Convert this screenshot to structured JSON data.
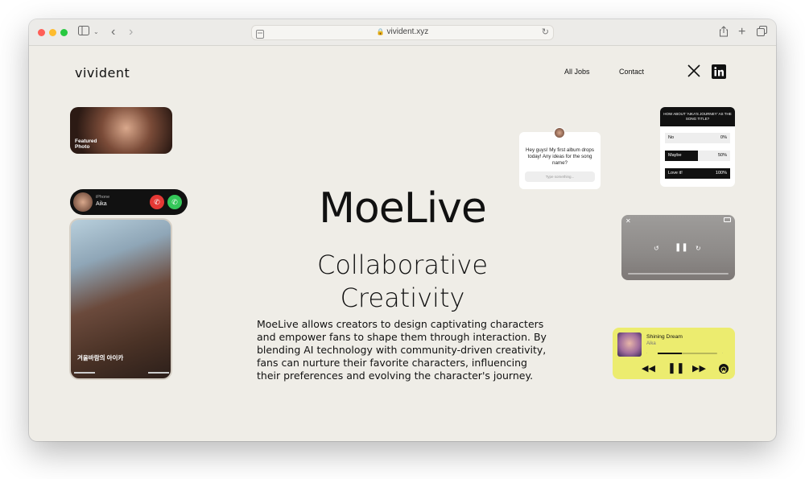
{
  "browser": {
    "url": "vivident.xyz",
    "traffic_light_colors": [
      "#ff5f57",
      "#febc2e",
      "#28c840"
    ]
  },
  "header": {
    "logo": "vivident",
    "nav": [
      {
        "label": "All Jobs"
      },
      {
        "label": "Contact"
      }
    ],
    "social_icons": [
      "x-icon",
      "linkedin-icon"
    ]
  },
  "hero": {
    "title": "MoeLive",
    "subtitle_line1": "Collaborative",
    "subtitle_line2": "Creativity",
    "description": "MoeLive allows creators to design captivating characters and empower fans to shape them through interaction. By blending AI technology with community-driven creativity, fans can nurture their favorite characters, influencing their preferences and evolving the character's journey."
  },
  "featured_photo": {
    "label_line1": "Featured",
    "label_line2": "Photo"
  },
  "call": {
    "device": "iPhone",
    "caller": "Aika",
    "decline_color": "#e53935",
    "accept_color": "#34c759"
  },
  "phone_card": {
    "caption": "겨울바람의 아이카"
  },
  "chat": {
    "message": "Hey guys! My first album drops today! Any ideas for the song name?",
    "input_placeholder": "Type something..."
  },
  "poll": {
    "question": "HOW ABOUT 'AIKA'S JOURNEY' AS THE SONG TITLE?",
    "options": [
      {
        "label": "No",
        "pct": "0%",
        "value": 0
      },
      {
        "label": "Maybe",
        "pct": "50%",
        "value": 50
      },
      {
        "label": "Love it!",
        "pct": "100%",
        "value": 100
      }
    ]
  },
  "video": {
    "progress": 0.0
  },
  "music": {
    "title": "Shining Dream",
    "artist": "Aika",
    "progress": 0.4,
    "accent": "#ecec6f"
  }
}
